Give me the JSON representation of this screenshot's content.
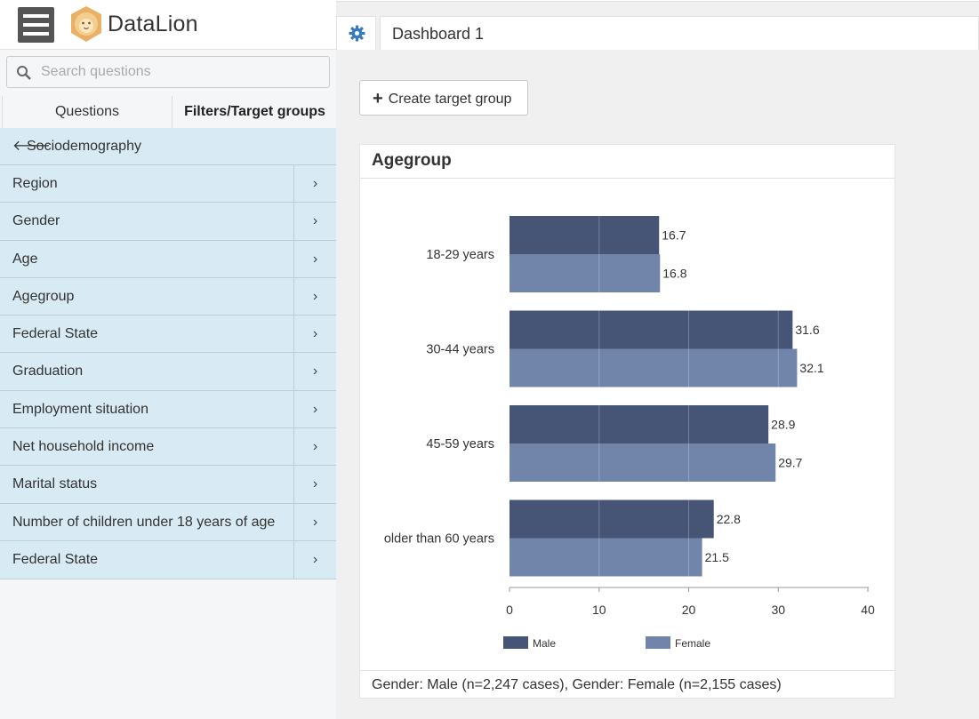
{
  "app": {
    "brand": "DataLion"
  },
  "sidebar": {
    "search_placeholder": "Search questions",
    "tabs": {
      "questions": "Questions",
      "filters": "Filters/Target groups"
    },
    "back_label": "Sociodemography",
    "items": [
      {
        "label": "Region"
      },
      {
        "label": "Gender"
      },
      {
        "label": "Age"
      },
      {
        "label": "Agegroup"
      },
      {
        "label": "Federal State"
      },
      {
        "label": "Graduation"
      },
      {
        "label": "Employment situation"
      },
      {
        "label": "Net household income"
      },
      {
        "label": "Marital status"
      },
      {
        "label": "Number of children under 18 years of age"
      },
      {
        "label": "Federal State"
      }
    ],
    "chevron": "›"
  },
  "main": {
    "dashboard_tab": "Dashboard 1",
    "create_button": "Create target group",
    "card_title": "Agegroup",
    "card_footer": "Gender: Male (n=2,247 cases), Gender: Female (n=2,155 cases)"
  },
  "colors": {
    "male": "#465475",
    "female": "#7185aa",
    "accent": "#3a7bbf"
  },
  "chart_data": {
    "type": "bar",
    "orientation": "horizontal",
    "categories": [
      "18-29 years",
      "30-44 years",
      "45-59 years",
      "older than 60 years"
    ],
    "series": [
      {
        "name": "Male",
        "values": [
          16.7,
          31.6,
          28.9,
          22.8
        ]
      },
      {
        "name": "Female",
        "values": [
          16.8,
          32.1,
          29.7,
          21.5
        ]
      }
    ],
    "xlim": [
      0,
      40
    ],
    "xticks": [
      0,
      10,
      20,
      30,
      40
    ],
    "legend_position": "bottom-left",
    "grid": true
  }
}
